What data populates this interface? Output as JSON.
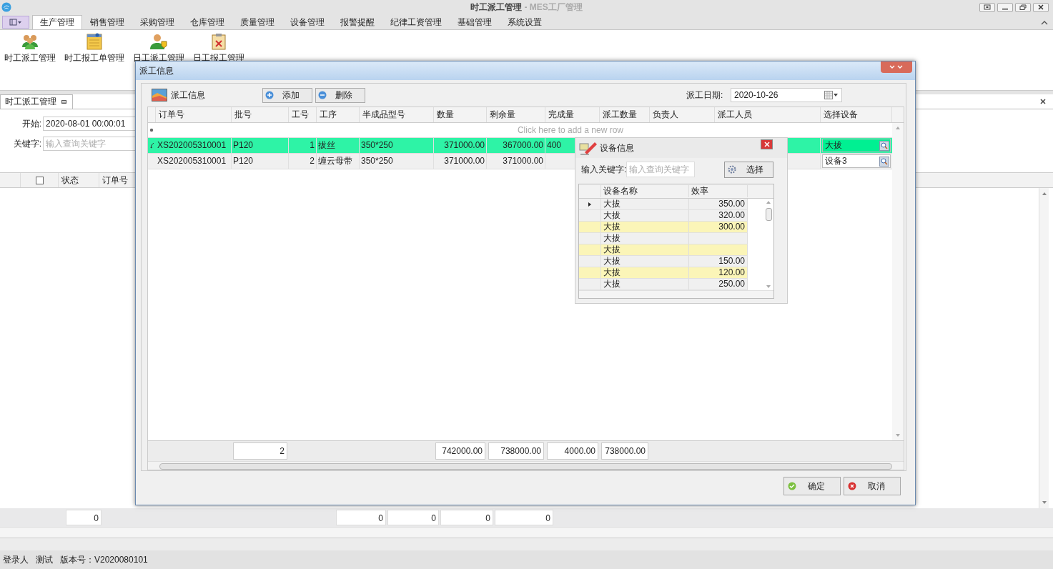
{
  "window": {
    "title": "时工派工管理",
    "subtitle": "- MES工厂管理"
  },
  "menu_tabs": [
    {
      "label": "生产管理",
      "selected": true
    },
    {
      "label": "销售管理",
      "selected": false
    },
    {
      "label": "采购管理",
      "selected": false
    },
    {
      "label": "仓库管理",
      "selected": false
    },
    {
      "label": "质量管理",
      "selected": false
    },
    {
      "label": "设备管理",
      "selected": false
    },
    {
      "label": "报警提醒",
      "selected": false
    },
    {
      "label": "纪律工资管理",
      "selected": false
    },
    {
      "label": "基础管理",
      "selected": false
    },
    {
      "label": "系统设置",
      "selected": false
    }
  ],
  "ribbon_items": [
    {
      "label": "时工派工管理",
      "kind": "people"
    },
    {
      "label": "时工报工单管理",
      "kind": "notepad"
    },
    {
      "label": "日工派工管理",
      "kind": "person"
    },
    {
      "label": "日工报工管理",
      "kind": "clipboard"
    }
  ],
  "document_tab": {
    "label": "时工派工管理"
  },
  "filter": {
    "start_label": "开始:",
    "start_value": "2020-08-01 00:00:01",
    "keyword_label": "关键字:",
    "keyword_placeholder": "输入查询关键字"
  },
  "main_grid": {
    "columns": [
      {
        "kind": "checkbox",
        "checked": false
      },
      {
        "kind": "text",
        "label": "状态"
      },
      {
        "kind": "text",
        "label": "订单号"
      }
    ],
    "totals": [
      "0",
      "0",
      "0",
      "0",
      "0"
    ]
  },
  "dialog": {
    "title": "派工信息",
    "panel_title": "派工信息",
    "buttons": [
      {
        "label": "添加",
        "kind": "add"
      },
      {
        "label": "删除",
        "kind": "remove"
      }
    ],
    "date_label": "派工日期:",
    "date_value": "2020-10-26",
    "columns": [
      {
        "label": "订单号"
      },
      {
        "label": "批号",
        "total": "2"
      },
      {
        "label": "工号"
      },
      {
        "label": "工序"
      },
      {
        "label": "半成品型号"
      },
      {
        "label": "数量",
        "total": "742000.00"
      },
      {
        "label": "剩余量",
        "total": "738000.00"
      },
      {
        "label": "完成量",
        "total": "4000.00"
      },
      {
        "label": "派工数量",
        "total": "738000.00"
      },
      {
        "label": "负责人"
      },
      {
        "label": "派工人员"
      },
      {
        "label": "选择设备"
      }
    ],
    "new_row_hint": "Click here to add a new row",
    "rows": [
      {
        "selected": true,
        "cells": [
          "XS202005310001",
          "P120",
          "1",
          "拔丝",
          "350*250",
          "371000.00",
          "367000.00",
          "400"
        ],
        "equipment": "大拔"
      },
      {
        "selected": false,
        "cells": [
          "XS202005310001",
          "P120",
          "2",
          "缠云母带",
          "350*250",
          "371000.00",
          "371000.00"
        ],
        "equipment": "设备3"
      }
    ],
    "footer_buttons": [
      {
        "label": "确定",
        "kind": "ok"
      },
      {
        "label": "取消",
        "kind": "cancel"
      }
    ],
    "popup": {
      "title": "设备信息",
      "keyword_label": "输入关键字:",
      "keyword_placeholder": "输入查询关键字",
      "button": "选择",
      "columns": [
        "设备名称",
        "效率"
      ],
      "rows": [
        {
          "name": "大拔",
          "rate": "350.00",
          "selected": true,
          "highlighted": false
        },
        {
          "name": "大拔",
          "rate": "320.00",
          "selected": false,
          "highlighted": false
        },
        {
          "name": "大拔",
          "rate": "300.00",
          "selected": false,
          "highlighted": true
        },
        {
          "name": "大拔",
          "selected": false,
          "highlighted": false
        },
        {
          "name": "大拔",
          "selected": false,
          "highlighted": true
        },
        {
          "name": "大拔",
          "rate": "150.00",
          "selected": false,
          "highlighted": false
        },
        {
          "name": "大拔",
          "rate": "120.00",
          "selected": false,
          "highlighted": true
        },
        {
          "name": "大拔",
          "rate": "250.00",
          "selected": false,
          "highlighted": false
        }
      ]
    }
  },
  "status_bar": {
    "user_label": "登录人",
    "user": "测试",
    "version": "版本号：V2020080101"
  }
}
